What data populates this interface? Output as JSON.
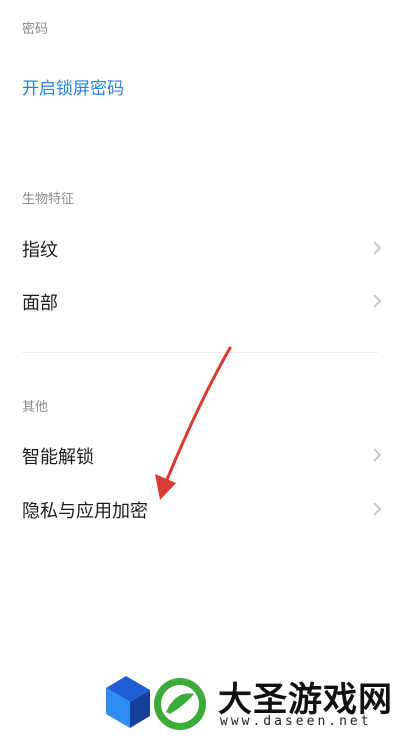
{
  "sections": {
    "password": {
      "header": "密码",
      "link": "开启锁屏密码"
    },
    "biometrics": {
      "header": "生物特征",
      "items": [
        {
          "label": "指纹"
        },
        {
          "label": "面部"
        }
      ]
    },
    "other": {
      "header": "其他",
      "items": [
        {
          "label": "智能解锁"
        },
        {
          "label": "隐私与应用加密"
        }
      ]
    }
  },
  "annotation": {
    "color": "#d93a32"
  },
  "watermark": {
    "title": "大圣游戏网",
    "url": "www.daseen.net"
  },
  "colors": {
    "link": "#2f7fe0",
    "chevron": "#c4c4c4"
  }
}
